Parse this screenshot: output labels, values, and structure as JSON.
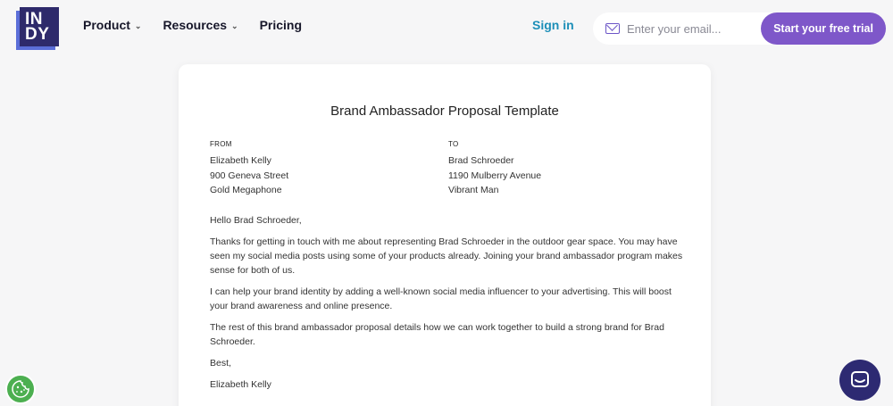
{
  "brand": {
    "logo_line1": "IN",
    "logo_line2": "DY"
  },
  "nav": {
    "items": [
      {
        "label": "Product"
      },
      {
        "label": "Resources"
      },
      {
        "label": "Pricing"
      }
    ]
  },
  "header": {
    "signin_label": "Sign in",
    "email_placeholder": "Enter your email...",
    "trial_label": "Start your free trial"
  },
  "document": {
    "title": "Brand Ambassador Proposal Template",
    "from": {
      "label": "FROM",
      "lines": [
        "Elizabeth Kelly",
        "900 Geneva Street",
        "Gold Megaphone"
      ]
    },
    "to": {
      "label": "TO",
      "lines": [
        "Brad Schroeder",
        "1190 Mulberry Avenue",
        "Vibrant Man"
      ]
    },
    "paragraphs": [
      "Hello Brad Schroeder,",
      "Thanks for getting in touch with me about representing Brad Schroeder in the outdoor gear space. You may have seen my social media posts using some of your products already. Joining your brand ambassador program makes sense for both of us.",
      "I can help your brand identity by adding a well-known social media influencer to your advertising. This will boost your brand awareness and online presence.",
      "The rest of this brand ambassador proposal details how we can work together to build a strong brand for Brad Schroeder.",
      "Best,",
      "Elizabeth Kelly"
    ]
  },
  "colors": {
    "accent": "#7e57c9",
    "link": "#1d8fb8",
    "logo_dark": "#2e2a6b",
    "logo_light": "#5b6ed8",
    "cookie": "#4caf50",
    "chat": "#2d2a72"
  },
  "icons": {
    "chevron": "chevron-down-icon",
    "mail": "mail-icon",
    "cookie": "cookie-icon",
    "chat": "chat-icon"
  }
}
